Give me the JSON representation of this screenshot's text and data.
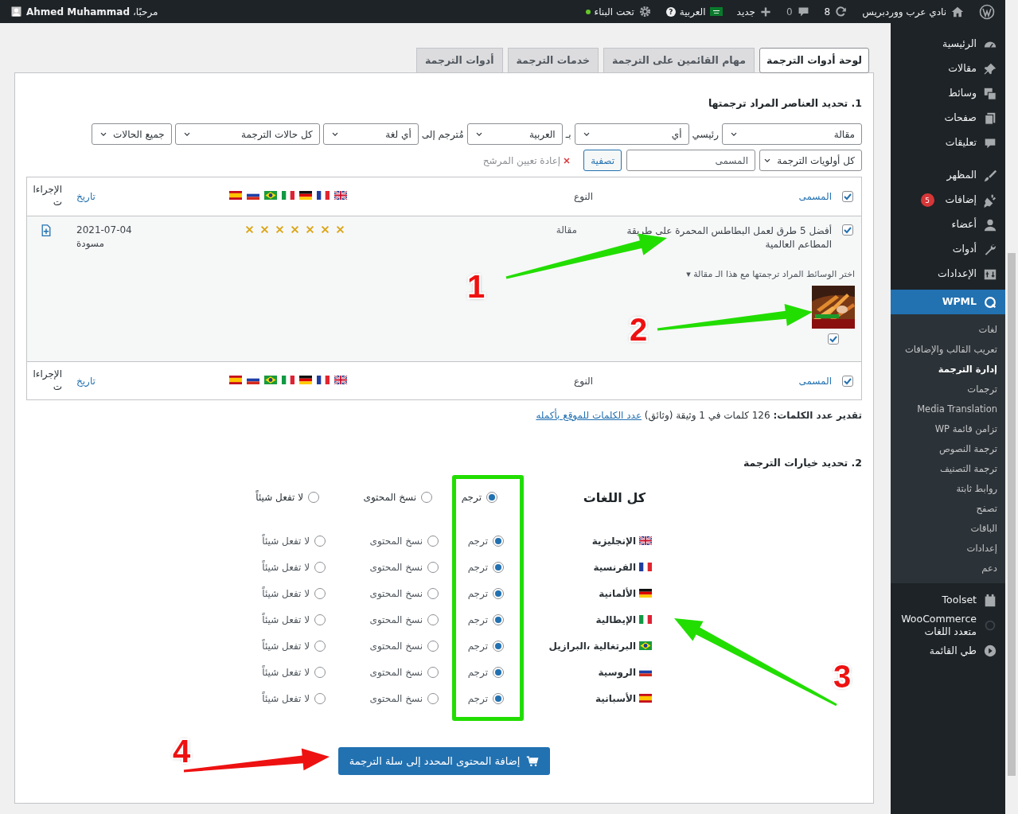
{
  "admin_bar": {
    "site_name": "نادي عرب ووردبريس",
    "updates": "8",
    "comments": "0",
    "new": "جديد",
    "language": "العربية",
    "help": "?",
    "maintenance": "تحت البناء",
    "greeting": "مرحبًا، **Ahmed Muhammad**"
  },
  "sidebar": {
    "items": [
      {
        "label": "الرئيسية",
        "selected": false
      },
      {
        "label": "مقالات",
        "selected": false
      },
      {
        "label": "وسائط",
        "selected": false
      },
      {
        "label": "صفحات",
        "selected": false
      },
      {
        "label": "تعليقات",
        "selected": false
      },
      {
        "label": "المظهر",
        "selected": false
      },
      {
        "label": "إضافات",
        "badge": "5",
        "selected": false
      },
      {
        "label": "أعضاء",
        "selected": false
      },
      {
        "label": "أدوات",
        "selected": false
      },
      {
        "label": "الإعدادات",
        "selected": false
      },
      {
        "label": "WPML",
        "selected": true,
        "submenu": [
          {
            "label": "لغات",
            "selected": false
          },
          {
            "label": "تعريب القالب والإضافات",
            "selected": false
          },
          {
            "label": "إدارة الترجمة",
            "selected": true
          },
          {
            "label": "ترجمات",
            "selected": false
          },
          {
            "label": "Media Translation",
            "selected": false
          },
          {
            "label": "تزامن قائمة WP",
            "selected": false
          },
          {
            "label": "ترجمة النصوص",
            "selected": false
          },
          {
            "label": "ترجمة التصنيف",
            "selected": false
          },
          {
            "label": "روابط ثابتة",
            "selected": false
          },
          {
            "label": "تصفح",
            "selected": false
          },
          {
            "label": "الباقات",
            "selected": false
          },
          {
            "label": "إعدادات",
            "selected": false
          },
          {
            "label": "دعم",
            "selected": false
          }
        ]
      },
      {
        "label": "Toolset",
        "selected": false
      },
      {
        "label": "WooCommerce متعدد اللغات",
        "selected": false
      },
      {
        "label": "طي القائمة",
        "selected": false
      }
    ]
  },
  "tabs": [
    {
      "label": "لوحة أدوات الترجمة",
      "selected": true
    },
    {
      "label": "مهام القائمين على الترجمة",
      "selected": false
    },
    {
      "label": "خدمات الترجمة",
      "selected": false
    },
    {
      "label": "أدوات الترجمة",
      "selected": false
    }
  ],
  "section1": {
    "heading": "1. تحديد العناصر المراد ترجمتها",
    "filters": [
      {
        "kind": "select",
        "value": "مقالة"
      },
      {
        "kind": "label",
        "text": "رئيسي"
      },
      {
        "kind": "select",
        "value": "أي"
      },
      {
        "kind": "label",
        "text": "بـ"
      },
      {
        "kind": "select",
        "value": "العربية"
      },
      {
        "kind": "label",
        "text": "مُترجم إلى"
      },
      {
        "kind": "select",
        "value": "أي لغة"
      },
      {
        "kind": "select",
        "value": "كل حالات الترجمة"
      },
      {
        "kind": "select",
        "value": "جميع الحالات"
      }
    ],
    "priority": "كل أولويات الترجمة",
    "search": {
      "placeholder": "المسمى"
    },
    "filter_button": "تصفية",
    "reset": "إعادة تعيين المرشح"
  },
  "table": {
    "columns": [
      "المسمى",
      "النوع",
      "تاريخ",
      "الإجراءات"
    ],
    "footer_columns": [
      "المسمى",
      "النوع",
      "تاريخ",
      "الإجراءات"
    ],
    "header_checked": true,
    "footer_checked": true,
    "rows": [
      {
        "checked": true,
        "title": "أفضل 5 طرق لعمل البطاطس المحمرة على طريقة المطاعم العالمية",
        "type": "مقالة",
        "statuses": [
          {
            "translated": false
          },
          {
            "translated": false
          },
          {
            "translated": false
          },
          {
            "translated": false
          },
          {
            "translated": false
          },
          {
            "translated": false
          },
          {
            "translated": false
          }
        ],
        "date": "2021-07-04",
        "status": "مسودة",
        "media": {
          "toggle": "اختر الوسائط المراد ترجمتها مع هذا الـ مقالة ▾",
          "items": [
            {
              "kind": "picture",
              "checked": true
            }
          ]
        }
      }
    ]
  },
  "word_count": {
    "text": "**تقدير عدد الكلمات:** 126 كلمات في 1 وثيقة (وثائق)",
    "link": "عدد الكلمات للموقع بأكمله"
  },
  "section2": {
    "heading": "2. تحديد خيارات الترجمة",
    "all_languages": {
      "label": "كل اللغات",
      "options": [
        {
          "label": "ترجم",
          "selected": true
        },
        {
          "label": "نسخ المحتوى",
          "selected": false
        },
        {
          "label": "لا تفعل شيئاً",
          "selected": false
        }
      ]
    },
    "languages": [
      {
        "name": "الإنجليزية",
        "options": [
          {
            "label": "ترجم",
            "selected": true
          },
          {
            "label": "نسخ المحتوى",
            "selected": false
          },
          {
            "label": "لا تفعل شيئاً",
            "selected": false
          }
        ]
      },
      {
        "name": "الفرنسية",
        "options": [
          {
            "label": "ترجم",
            "selected": true
          },
          {
            "label": "نسخ المحتوى",
            "selected": false
          },
          {
            "label": "لا تفعل شيئاً",
            "selected": false
          }
        ]
      },
      {
        "name": "الألمانية",
        "options": [
          {
            "label": "ترجم",
            "selected": true
          },
          {
            "label": "نسخ المحتوى",
            "selected": false
          },
          {
            "label": "لا تفعل شيئاً",
            "selected": false
          }
        ]
      },
      {
        "name": "الإيطالية",
        "options": [
          {
            "label": "ترجم",
            "selected": true
          },
          {
            "label": "نسخ المحتوى",
            "selected": false
          },
          {
            "label": "لا تفعل شيئاً",
            "selected": false
          }
        ]
      },
      {
        "name": "البرتغالية ،البرازيل",
        "options": [
          {
            "label": "ترجم",
            "selected": true
          },
          {
            "label": "نسخ المحتوى",
            "selected": false
          },
          {
            "label": "لا تفعل شيئاً",
            "selected": false
          }
        ]
      },
      {
        "name": "الروسية",
        "options": [
          {
            "label": "ترجم",
            "selected": true
          },
          {
            "label": "نسخ المحتوى",
            "selected": false
          },
          {
            "label": "لا تفعل شيئاً",
            "selected": false
          }
        ]
      },
      {
        "name": "الأسبانية",
        "options": [
          {
            "label": "ترجم",
            "selected": true
          },
          {
            "label": "نسخ المحتوى",
            "selected": false
          },
          {
            "label": "لا تفعل شيئاً",
            "selected": false
          }
        ]
      }
    ],
    "submit": "إضافة المحتوى المحدد إلى سلة الترجمة"
  },
  "annotations": [
    {
      "label": "1",
      "color": "#22dd00"
    },
    {
      "label": "2",
      "color": "#22dd00"
    },
    {
      "label": "3",
      "color": "#22dd00"
    },
    {
      "label": "4",
      "color": "#ee1111"
    }
  ]
}
